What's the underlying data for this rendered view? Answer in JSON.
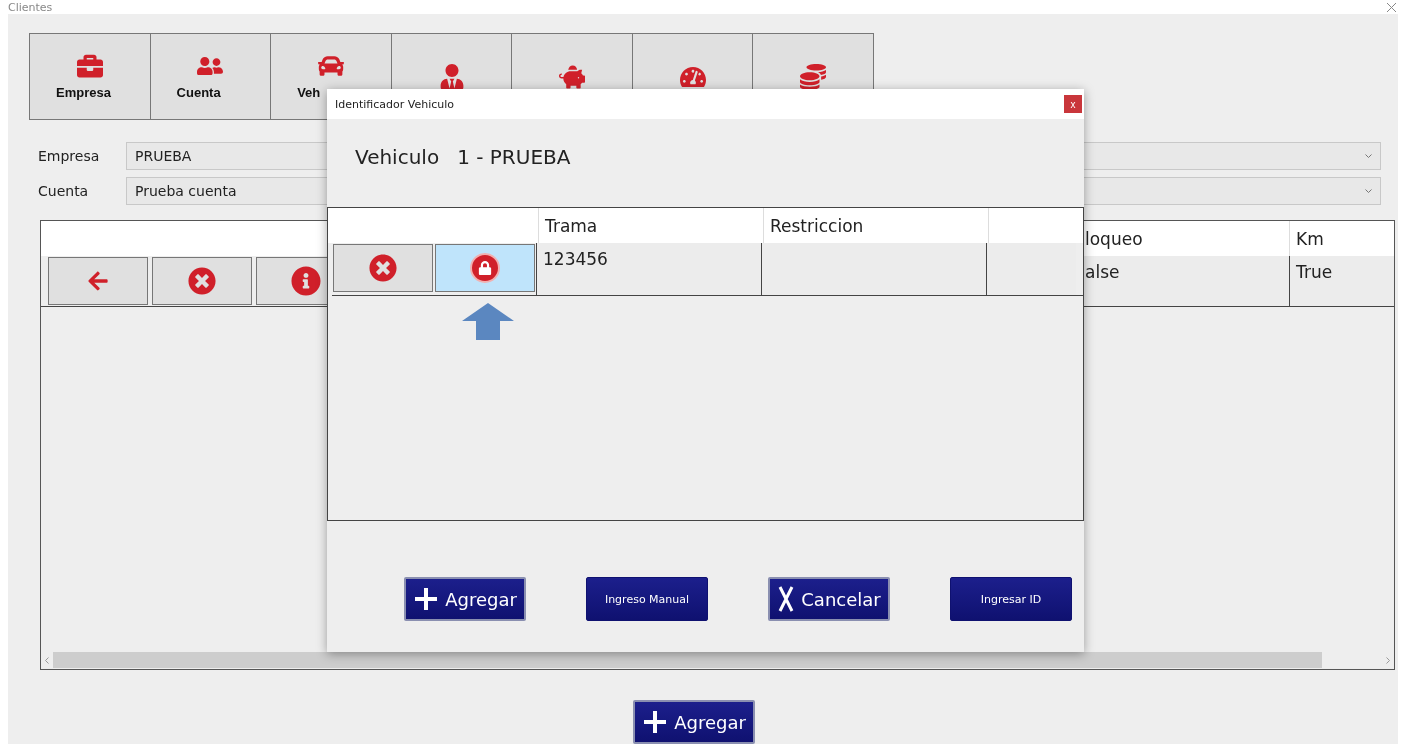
{
  "window": {
    "title": "Clientes"
  },
  "tabs": [
    {
      "kind": "briefcase",
      "label": "Empresa"
    },
    {
      "kind": "people",
      "label": "Cuenta"
    },
    {
      "kind": "car",
      "label": "Veh"
    },
    {
      "kind": "driver"
    },
    {
      "kind": "piggy"
    },
    {
      "kind": "gauge"
    },
    {
      "kind": "coins"
    }
  ],
  "fields": [
    {
      "label": "Empresa",
      "value": "PRUEBA"
    },
    {
      "label": "Cuenta",
      "value": "Prueba cuenta"
    }
  ],
  "main_table": {
    "columns": [
      "loqueo",
      "Km"
    ],
    "rows": [
      {
        "cells": [
          "alse",
          "True"
        ]
      }
    ]
  },
  "dialog": {
    "title": "Identificador Vehiculo",
    "heading": "Vehiculo",
    "value": "1 - PRUEBA",
    "table": {
      "columns": [
        "Trama",
        "Restriccion"
      ],
      "rows": [
        {
          "lock_selected": true,
          "cells": [
            "123456"
          ]
        }
      ]
    },
    "buttons": [
      {
        "label": "Agregar",
        "kind": "plus"
      },
      {
        "label": "Ingreso Manual",
        "kind": "plain"
      },
      {
        "label": "Cancelar",
        "kind": "x"
      },
      {
        "label": "Ingresar ID",
        "kind": "plain"
      }
    ]
  },
  "bottom_button": {
    "label": "Agregar",
    "kind": "plus"
  }
}
